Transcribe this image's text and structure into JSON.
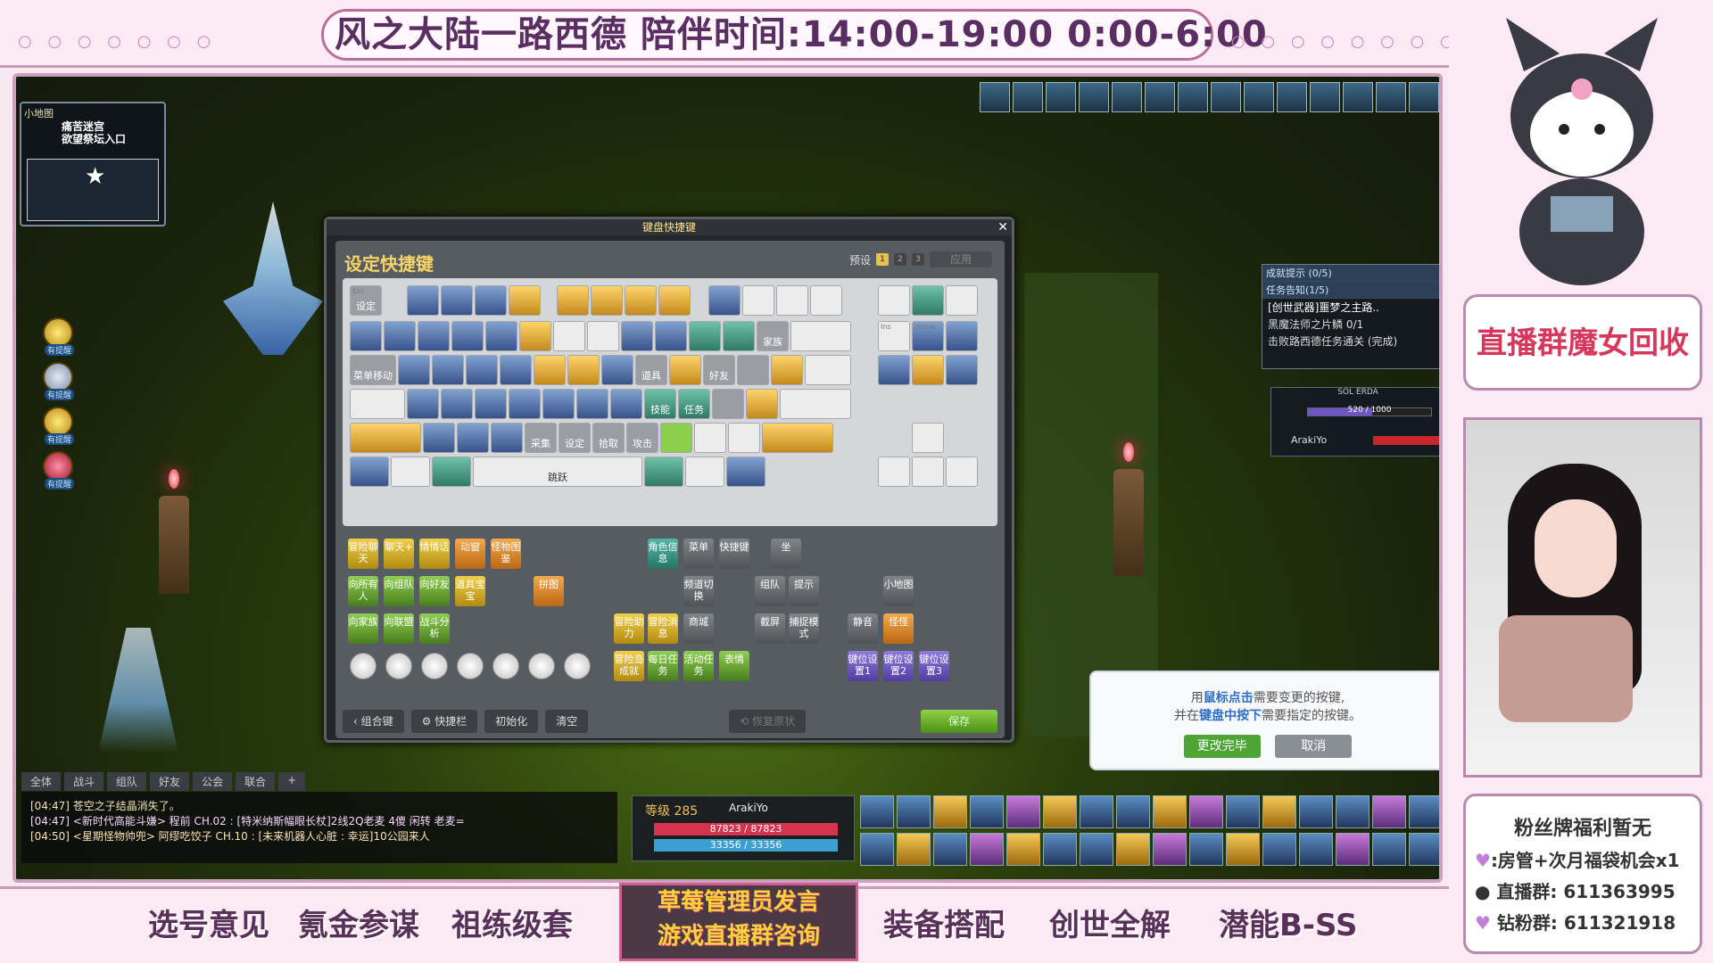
{
  "stream": {
    "title": "风之大陆一路西德   陪伴时间:14:00-19:00 0:00-6:00",
    "bottom_links": [
      "选号意见",
      "氪金参谋",
      "祖练级套",
      "装备搭配",
      "创世全解",
      "潜能B-SS"
    ],
    "center_box": [
      "草莓管理员发言",
      "游戏直播群咨询"
    ],
    "right_banner": "直播群魔女回收",
    "info": {
      "heading": "粉丝牌福利暂无",
      "line1": ":房管+次月福袋机会x1",
      "line2": "直播群: 611363995",
      "line3": "钻粉群: 611321918"
    }
  },
  "game": {
    "minimap": {
      "header": "小地图",
      "location_line1": "痛苦迷宫",
      "location_line2": "欲望祭坛入口"
    },
    "side_labels": [
      "有提醒",
      "有提醒",
      "有提醒",
      "有提醒"
    ],
    "dialog": {
      "titlebar": "键盘快捷键",
      "title": "设定快捷键",
      "preset_label": "预设",
      "preset_pages": [
        "1",
        "2",
        "3"
      ],
      "apply_label": "应用",
      "keys": [
        {
          "k": "Esc",
          "t": "设定"
        },
        {
          "k": "Ins",
          "t": ""
        },
        {
          "k": "Home",
          "t": ""
        },
        {
          "k": "",
          "t": "菜单移动"
        },
        {
          "k": "",
          "t": "道具"
        },
        {
          "k": "",
          "t": "好友"
        },
        {
          "k": "",
          "t": "家族"
        },
        {
          "k": "",
          "t": "技能"
        },
        {
          "k": "",
          "t": "任务"
        },
        {
          "k": "",
          "t": "采集"
        },
        {
          "k": "",
          "t": "设定"
        },
        {
          "k": "",
          "t": "拾取"
        },
        {
          "k": "",
          "t": "攻击"
        },
        {
          "k": "Space",
          "t": "跳跃"
        }
      ],
      "pool": [
        "冒险聊天",
        "聊天+",
        "情情话",
        "动窗",
        "怪物图鉴",
        "角色信息",
        "菜单",
        "快捷键",
        "坐",
        "向所有人",
        "向组队",
        "向好友",
        "道具宝宝",
        "拼图",
        "频道切换",
        "组队",
        "提示",
        "小地图",
        "向家族",
        "向联盟",
        "战斗分析",
        "冒险助力",
        "冒险消息",
        "商城",
        "截屏",
        "捕捉模式",
        "静音",
        "怪怪",
        "冒险岛成就",
        "每日任务",
        "活动任务",
        "表情",
        "键位设置1",
        "键位设置2",
        "键位设置3"
      ],
      "buttons": {
        "combo": "组合键",
        "quickbar": "快捷栏",
        "reset": "初始化",
        "clear": "清空",
        "restore": "恢复原状",
        "save": "保存"
      }
    },
    "quest": {
      "header1": "成就提示 (0/5)",
      "header2": "任务告知(1/5)",
      "line1": "[创世武器]噩梦之主路..",
      "line2": "黑魔法师之片鳞  0/1",
      "line3": "击败路西德任务通关   (完成)"
    },
    "erda": {
      "label": "SOL ERDA",
      "value": "520 / 1000",
      "name": "ArakiYo"
    },
    "tip": {
      "line1_pre": "用",
      "line1_em": "鼠标点击",
      "line1_post": "需要变更的按键,",
      "line2_pre": "并在",
      "line2_em": "键盘中按下",
      "line2_post": "需要指定的按键。",
      "ok": "更改完毕",
      "cancel": "取消"
    },
    "chat_tabs": [
      "全体",
      "战斗",
      "组队",
      "好友",
      "公会",
      "联合",
      "+"
    ],
    "chat_lines": [
      "[04:47] 苍空之子结晶消失了。",
      "[04:47] <新时代高能斗嫌> 程前 CH.02 : [特米纳斯幅眼长杖]2线2Q老麦 4傻 闲转 老麦=",
      "[04:50] <星期怪物帅兜> 阿缪吃饺子 CH.10 : [未来机器人心脏 : 幸运]10公园来人"
    ],
    "status": {
      "level": "等级 285",
      "name": "ArakiYo",
      "hp": "87823 / 87823",
      "mp": "33356 / 33356"
    }
  }
}
